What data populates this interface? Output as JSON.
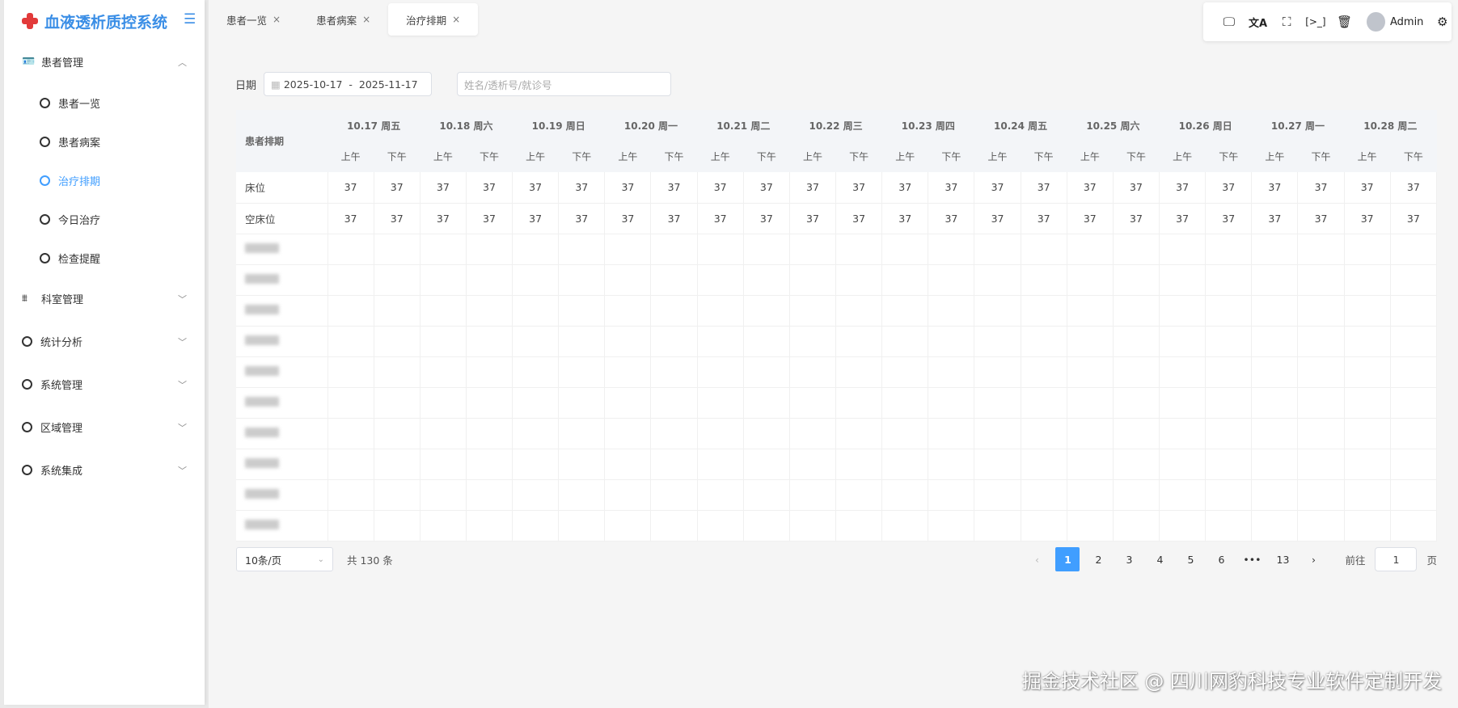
{
  "app": {
    "title": "血液透析质控系统"
  },
  "sidebar": {
    "items": [
      {
        "label": "患者管理",
        "icon": "id-card-icon",
        "expanded": true,
        "children": [
          {
            "label": "患者一览"
          },
          {
            "label": "患者病案"
          },
          {
            "label": "治疗排期",
            "active": true
          },
          {
            "label": "今日治疗"
          },
          {
            "label": "检查提醒"
          }
        ]
      },
      {
        "label": "科室管理",
        "icon": "sitemap-icon"
      },
      {
        "label": "统计分析",
        "icon": "circle-icon"
      },
      {
        "label": "系统管理",
        "icon": "circle-icon"
      },
      {
        "label": "区域管理",
        "icon": "circle-icon"
      },
      {
        "label": "系统集成",
        "icon": "circle-icon"
      }
    ]
  },
  "tabs": [
    {
      "label": "患者一览"
    },
    {
      "label": "患者病案"
    },
    {
      "label": "治疗排期",
      "active": true
    }
  ],
  "toolbar": {
    "user": "Admin"
  },
  "filter": {
    "date_label": "日期",
    "date_range": "2025-10-17  -  2025-11-17",
    "search_placeholder": "姓名/透析号/就诊号"
  },
  "table": {
    "corner": "患者排期",
    "shifts": [
      "上午",
      "下午"
    ],
    "dates": [
      "10.17 周五",
      "10.18 周六",
      "10.19 周日",
      "10.20 周一",
      "10.21 周二",
      "10.22 周三",
      "10.23 周四",
      "10.24 周五",
      "10.25 周六",
      "10.26 周日",
      "10.27 周一",
      "10.28 周二"
    ],
    "rows": [
      {
        "label": "床位",
        "values": [
          37,
          37,
          37,
          37,
          37,
          37,
          37,
          37,
          37,
          37,
          37,
          37,
          37,
          37,
          37,
          37,
          37,
          37,
          37,
          37,
          37,
          37,
          37,
          37
        ]
      },
      {
        "label": "空床位",
        "values": [
          37,
          37,
          37,
          37,
          37,
          37,
          37,
          37,
          37,
          37,
          37,
          37,
          37,
          37,
          37,
          37,
          37,
          37,
          37,
          37,
          37,
          37,
          37,
          37
        ]
      }
    ],
    "blurred_patient_rows": 10
  },
  "pagination": {
    "page_size": "10条/页",
    "total": "共 130 条",
    "pages": [
      "1",
      "2",
      "3",
      "4",
      "5",
      "6",
      "•••",
      "13"
    ],
    "current": "1",
    "goto_label": "前往",
    "goto_value": "1",
    "page_suffix": "页"
  },
  "watermark": "掘金技术社区 @ 四川网豹科技专业软件定制开发"
}
